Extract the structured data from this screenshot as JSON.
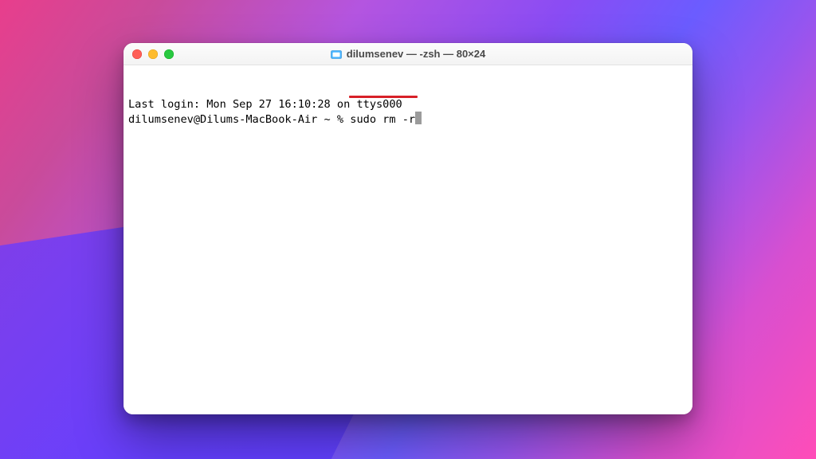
{
  "window": {
    "title": "dilumsenev — -zsh — 80×24"
  },
  "terminal": {
    "last_login": "Last login: Mon Sep 27 16:10:28 on ttys000",
    "prompt_text": "dilumsenev@Dilums-MacBook-Air ~ % ",
    "command": "sudo rm -r"
  }
}
